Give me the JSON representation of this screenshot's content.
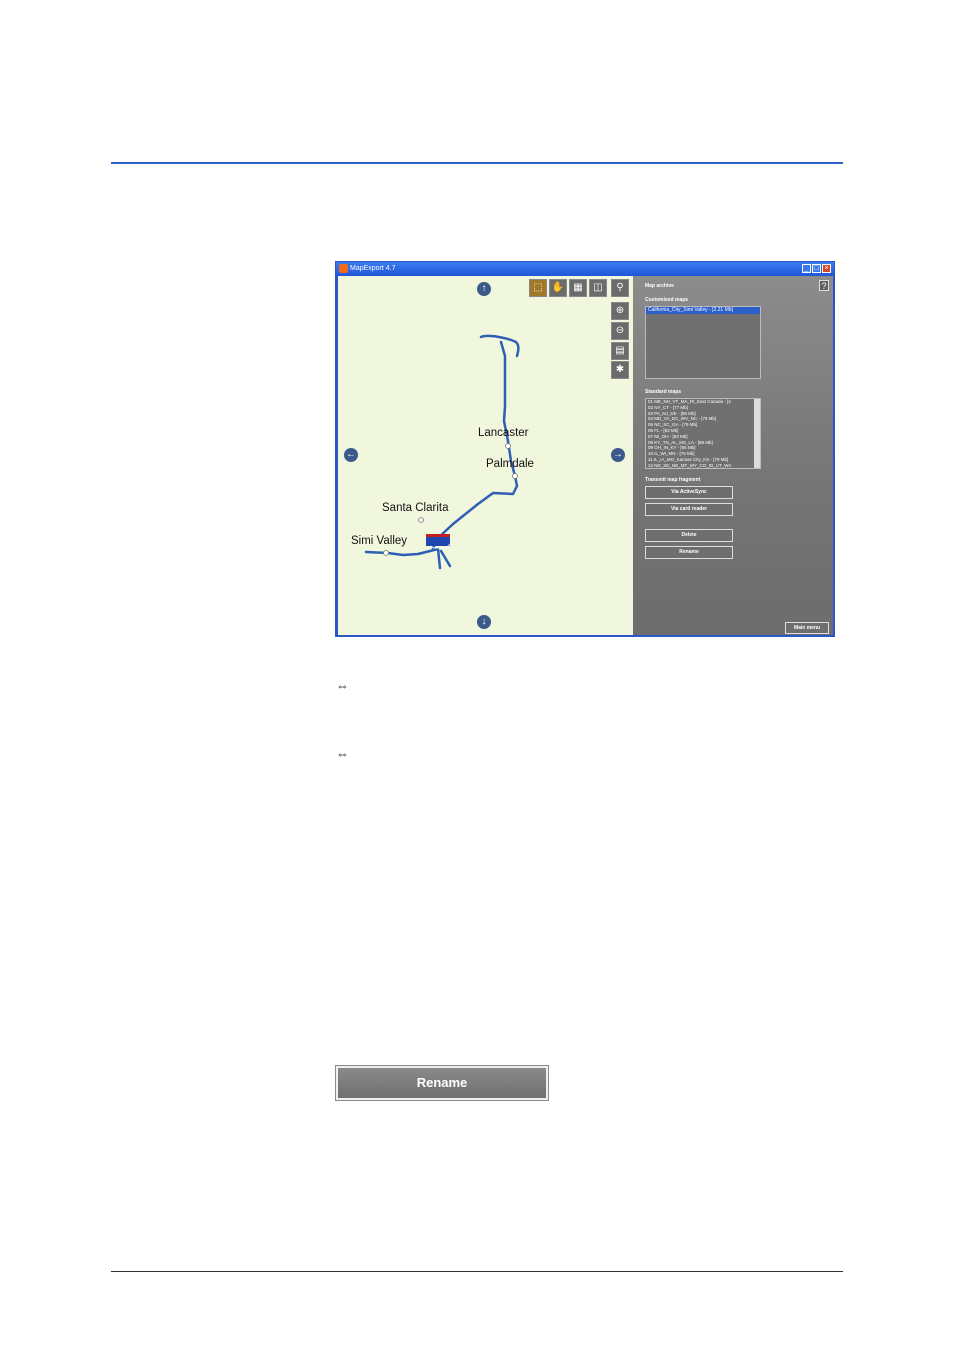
{
  "window": {
    "title": "MapExport 4.7"
  },
  "map": {
    "cities": [
      "Lancaster",
      "Palmdale",
      "Santa Clarita",
      "Simi Valley"
    ],
    "nav_arrows": {
      "up": "up-arrow-icon",
      "down": "down-arrow-icon",
      "left": "left-arrow-icon",
      "right": "right-arrow-icon"
    }
  },
  "panel": {
    "heading": "Map archive",
    "customised_label": "Customised maps",
    "customised_items": [
      "California_City_Simi Valley - [2.21 Mb]"
    ],
    "standard_label": "Standard maps",
    "standard_items": [
      "01 ME_NH_VT_MA_RI_East Canada - [4",
      "02 NY_CT - [77 Mb]",
      "03 PA_NJ_DE - [98 Mb]",
      "04 MD_VA_DC_WV_NC - [79 Mb]",
      "05 NC_SC_GA - [79 Mb]",
      "06 FL - [83 Mb]",
      "07 MI_OH - [63 Mb]",
      "08 KY_TN_AL_MS_LA - [88 Mb]",
      "09 OH_IN_KY - [65 Mb]",
      "10 IL_WI_MN - [75 Mb]",
      "11 IL_IA_MO_Kansas City_KS - [79 Mb]",
      "12 ND_SD_NE_MT_WY_CO_ID_UT_WA"
    ],
    "transmit_label": "Transmit map fragment",
    "activesync_button": "Via ActiveSync",
    "cardreader_button": "Via card reader",
    "delete_button": "Delete",
    "rename_button": "Rename",
    "mainmenu_button": "Main menu",
    "help": "?"
  },
  "doc": {
    "bullet_symbol": "⇔",
    "rename_button": "Rename"
  }
}
